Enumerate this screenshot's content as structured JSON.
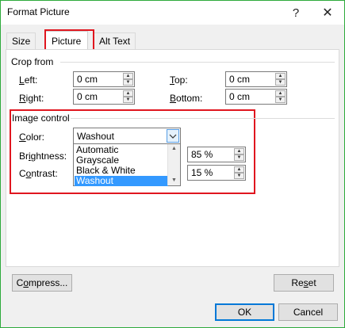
{
  "window": {
    "title": "Format Picture",
    "help": "?",
    "close": "✕"
  },
  "tabs": [
    {
      "label": "Size",
      "active": false
    },
    {
      "label": "Picture",
      "active": true
    },
    {
      "label": "Alt Text",
      "active": false
    }
  ],
  "crop": {
    "heading": "Crop from",
    "left": {
      "key": "L",
      "rest": "eft:",
      "value": "0 cm"
    },
    "right": {
      "key": "R",
      "rest": "ight:",
      "value": "0 cm"
    },
    "top": {
      "key": "T",
      "rest": "op:",
      "value": "0 cm"
    },
    "bottom": {
      "key": "B",
      "rest": "ottom:",
      "value": "0 cm"
    }
  },
  "image_control": {
    "heading": "Image control",
    "color": {
      "key": "C",
      "rest": "olor:",
      "value": "Washout",
      "options": [
        "Automatic",
        "Grayscale",
        "Black & White",
        "Washout"
      ]
    },
    "brightness": {
      "pre": "Br",
      "key": "i",
      "rest": "ghtness:",
      "value": "85 %"
    },
    "contrast": {
      "pre": "C",
      "key": "o",
      "rest": "ntrast:",
      "value": "15 %"
    }
  },
  "buttons": {
    "compress": {
      "pre": "C",
      "key": "o",
      "rest": "mpress..."
    },
    "reset": {
      "pre": "Re",
      "key": "s",
      "rest": "et"
    },
    "ok": "OK",
    "cancel": "Cancel"
  },
  "colors": {
    "highlight": "#e0161f",
    "selection": "#3399ff",
    "frame": "#2eaa3c"
  }
}
